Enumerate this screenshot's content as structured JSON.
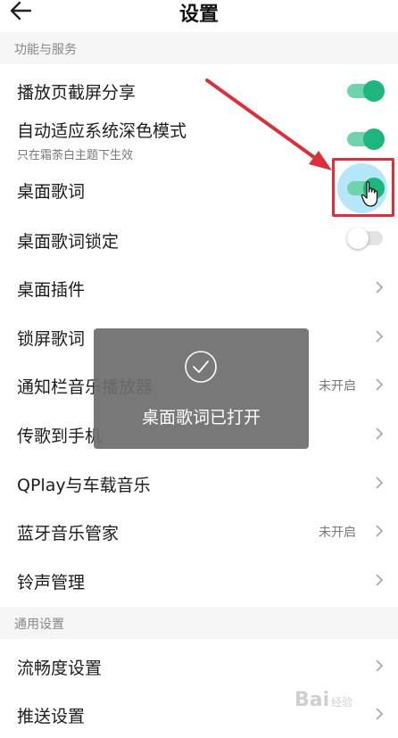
{
  "header": {
    "title": "设置",
    "back_icon": "arrow-left-icon"
  },
  "sections": {
    "functions": "功能与服务",
    "general": "通用设置"
  },
  "rows": {
    "screenshot_share": {
      "label": "播放页截屏分享",
      "toggle": "on"
    },
    "dark_mode": {
      "label": "自动适应系统深色模式",
      "sub": "只在霜荼白主题下生效",
      "toggle": "on"
    },
    "desktop_lyrics": {
      "label": "桌面歌词",
      "toggle": "on"
    },
    "desktop_lyrics_lock": {
      "label": "桌面歌词锁定",
      "toggle": "off"
    },
    "desktop_widget": {
      "label": "桌面插件"
    },
    "lockscreen_lyrics": {
      "label": "锁屏歌词"
    },
    "notification_player": {
      "label": "通知栏音乐播放器",
      "value": "未开启"
    },
    "transfer_to_phone": {
      "label": "传歌到手机"
    },
    "qplay": {
      "label": "QPlay与车载音乐"
    },
    "bluetooth": {
      "label": "蓝牙音乐管家",
      "value": "未开启"
    },
    "ringtone": {
      "label": "铃声管理"
    },
    "smoothness": {
      "label": "流畅度设置"
    },
    "push": {
      "label": "推送设置"
    }
  },
  "toast": {
    "message": "桌面歌词已打开",
    "icon": "check-circle-icon"
  },
  "watermark": {
    "brand": "Bai",
    "suffix": "经验"
  },
  "colors": {
    "toggle_on_track": "#6fd4ac",
    "toggle_on_knob": "#1fb57e",
    "annotation_red": "#dc2f3a",
    "section_bg": "#f5f5f5",
    "toast_bg": "#6e6e6e"
  }
}
